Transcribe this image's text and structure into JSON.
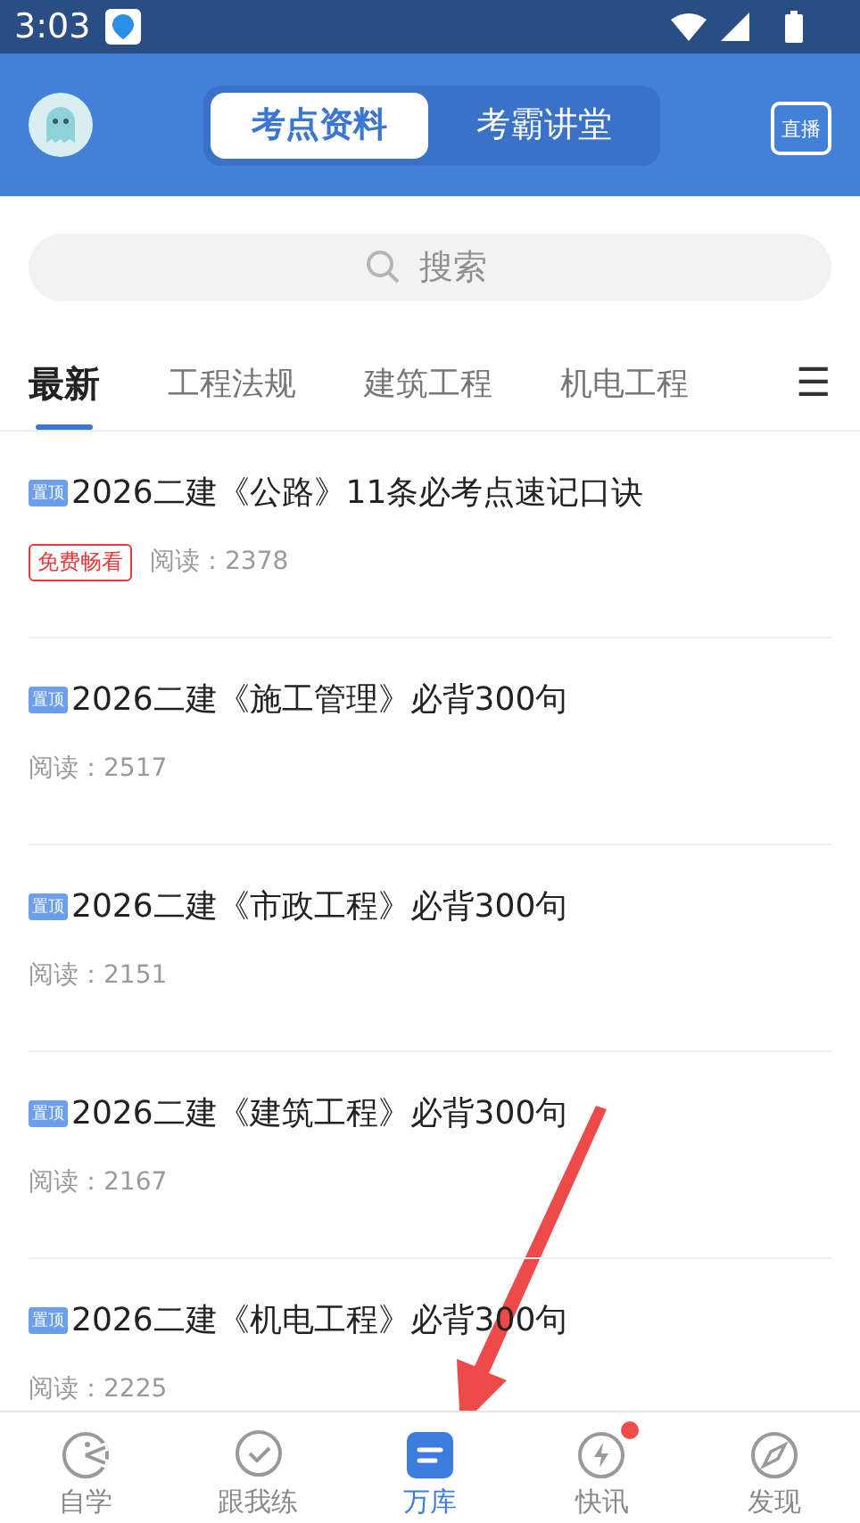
{
  "status_bar": {
    "time": "3:03"
  },
  "header": {
    "segments": [
      {
        "label": "考点资料",
        "selected": true
      },
      {
        "label": "考霸讲堂",
        "selected": false
      }
    ],
    "live_label": "直播"
  },
  "search": {
    "placeholder": "搜索"
  },
  "categories": [
    {
      "label": "最新",
      "selected": true
    },
    {
      "label": "工程法规",
      "selected": false
    },
    {
      "label": "建筑工程",
      "selected": false
    },
    {
      "label": "机电工程",
      "selected": false
    }
  ],
  "menu_icon": "☰",
  "articles": [
    {
      "badge": "置顶",
      "title": "2026二建《公路》11条必考点速记口诀",
      "tag": "免费畅看",
      "reads": "阅读：2378"
    },
    {
      "badge": "置顶",
      "title": "2026二建《施工管理》必背300句",
      "reads": "阅读：2517"
    },
    {
      "badge": "置顶",
      "title": "2026二建《市政工程》必背300句",
      "reads": "阅读：2151"
    },
    {
      "badge": "置顶",
      "title": "2026二建《建筑工程》必背300句",
      "reads": "阅读：2167"
    },
    {
      "badge": "置顶",
      "title": "2026二建《机电工程》必背300句",
      "reads": "阅读：2225"
    }
  ],
  "bottom_nav": [
    {
      "kind": "pacman",
      "label": "自学",
      "selected": false,
      "dot": false
    },
    {
      "kind": "check",
      "label": "跟我练",
      "selected": false,
      "dot": false
    },
    {
      "kind": "library",
      "label": "万库",
      "selected": true,
      "dot": false
    },
    {
      "kind": "bolt",
      "label": "快讯",
      "selected": false,
      "dot": true
    },
    {
      "kind": "compass",
      "label": "发现",
      "selected": false,
      "dot": false
    }
  ]
}
